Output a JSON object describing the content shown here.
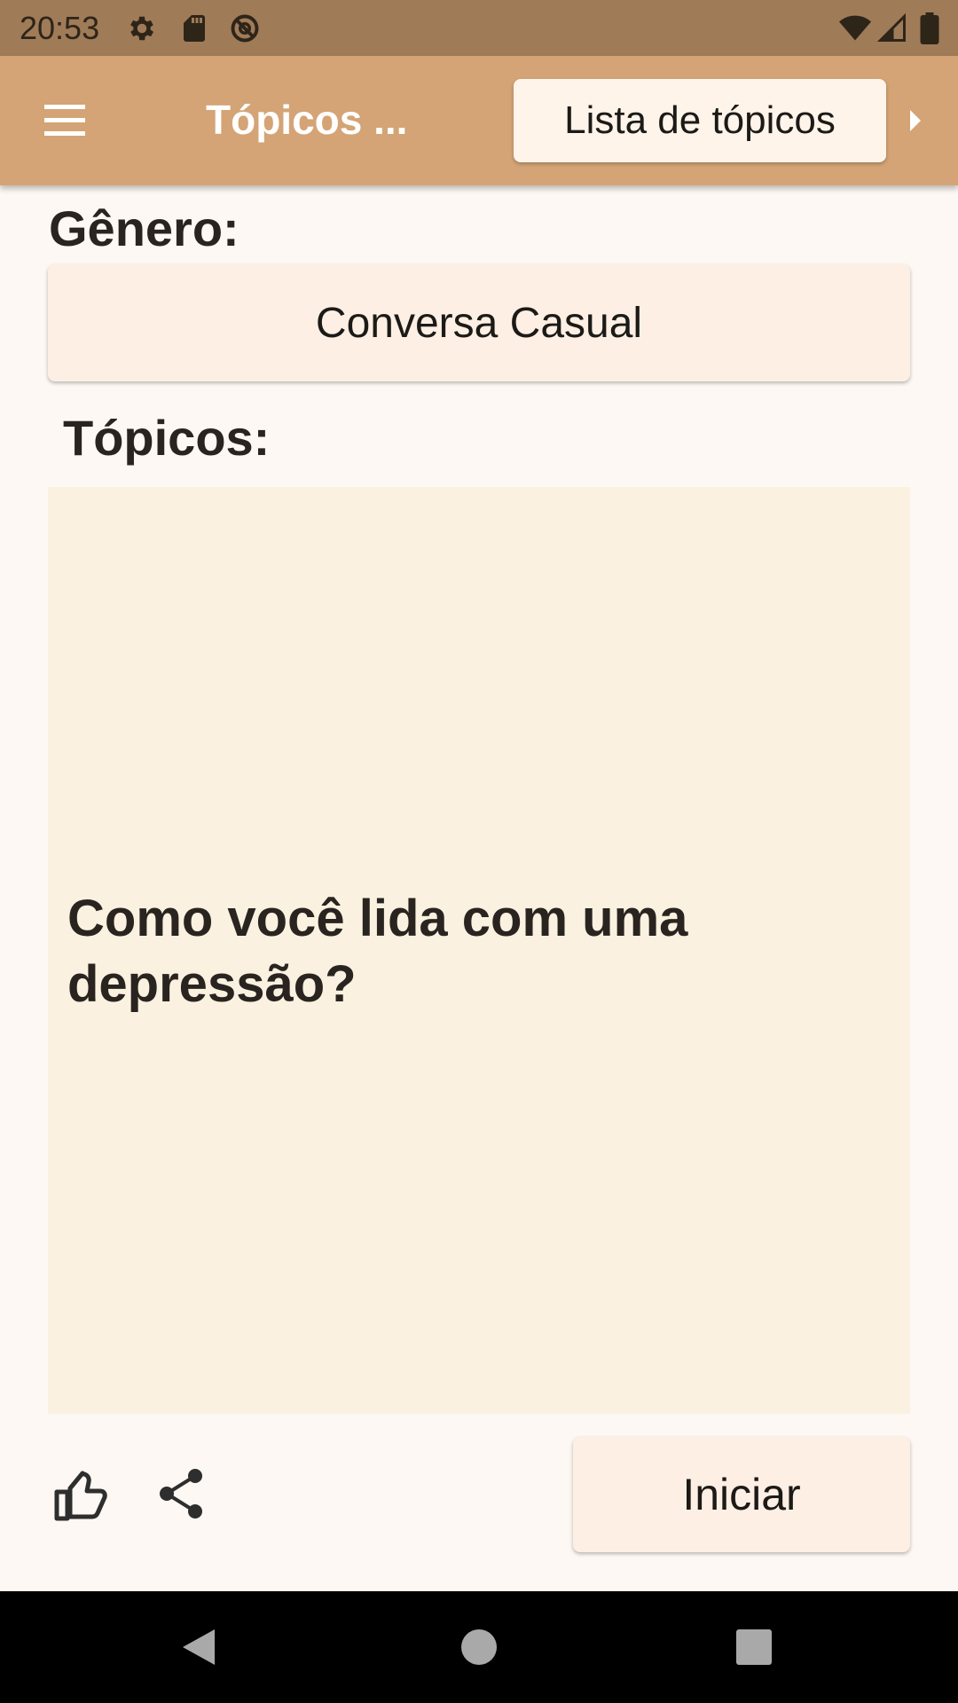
{
  "status_bar": {
    "time": "20:53",
    "icons": [
      "settings-icon",
      "sd-card-icon",
      "sync-icon",
      "wifi-icon",
      "signal-icon",
      "battery-icon"
    ]
  },
  "app_bar": {
    "title": "Tópicos ...",
    "topic_list_label": "Lista de tópicos",
    "icons": [
      "menu-icon",
      "arrow-right-icon"
    ]
  },
  "genre": {
    "label": "Gênero:",
    "value": "Conversa Casual"
  },
  "topics": {
    "label": "Tópicos:",
    "current": "Como você lida com uma depressão?"
  },
  "actions": {
    "start_label": "Iniciar",
    "icons": [
      "thumbs-up-icon",
      "share-icon"
    ]
  },
  "nav_bar": {
    "icons": [
      "back-icon",
      "home-icon",
      "recents-icon"
    ]
  },
  "colors": {
    "status_bar": "#a07b58",
    "app_bar": "#d4a476",
    "background": "#fdf8f3",
    "button": "#fdefe4",
    "card": "#faf1e0",
    "text": "#2a2420"
  }
}
